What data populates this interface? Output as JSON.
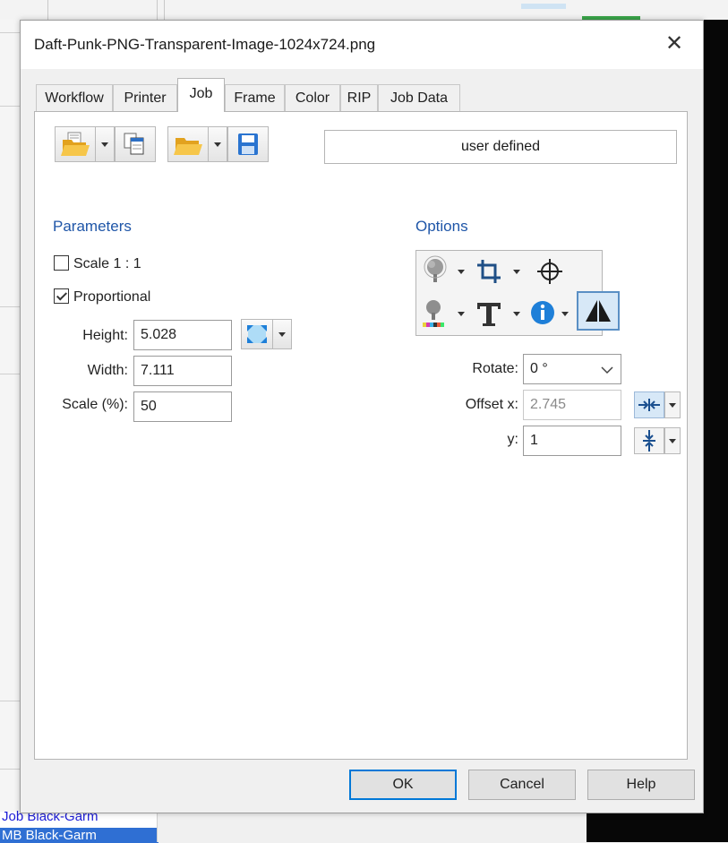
{
  "dialog": {
    "title": "Daft-Punk-PNG-Transparent-Image-1024x724.png",
    "close_glyph": "✕"
  },
  "tabs": [
    {
      "label": "Workflow",
      "active": false
    },
    {
      "label": "Printer",
      "active": false
    },
    {
      "label": "Job",
      "active": true
    },
    {
      "label": "Frame",
      "active": false
    },
    {
      "label": "Color",
      "active": false
    },
    {
      "label": "RIP",
      "active": false
    },
    {
      "label": "Job Data",
      "active": false
    }
  ],
  "toolbar": {
    "preset_value": "user defined",
    "icons": [
      "open-folder-icon",
      "copy-documents-icon",
      "open-folder-icon",
      "save-disk-icon"
    ]
  },
  "parameters": {
    "heading": "Parameters",
    "scale_1_1_label": "Scale 1 : 1",
    "scale_1_1_checked": false,
    "proportional_label": "Proportional",
    "proportional_checked": true,
    "height_label": "Height:",
    "height_value": "5.028",
    "width_label": "Width:",
    "width_value": "7.111",
    "scale_label": "Scale (%):",
    "scale_value": "50"
  },
  "options": {
    "heading": "Options",
    "icons": [
      "tree-marks-icon",
      "crop-icon",
      "crosshair-target-icon",
      "tree-colorbar-icon",
      "text-T-icon",
      "info-icon",
      "mirror-icon"
    ],
    "rotate_label": "Rotate:",
    "rotate_value": "0 °",
    "offset_x_label": "Offset x:",
    "offset_x_value": "2.745",
    "offset_y_label": "y:",
    "offset_y_value": "1"
  },
  "buttons": {
    "ok": "OK",
    "cancel": "Cancel",
    "help": "Help"
  },
  "background": {
    "list_rows": [
      "Job   Black-Garm",
      "MB   Black-Garm"
    ]
  },
  "colors": {
    "accent": "#1f56a8",
    "annotation": "#1d1dcf"
  }
}
